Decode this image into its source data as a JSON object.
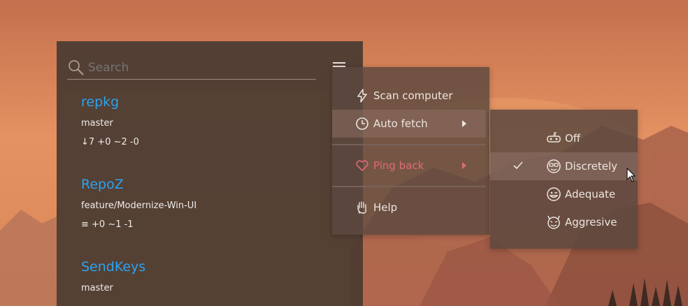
{
  "app": {
    "search": {
      "placeholder": "Search"
    },
    "repos": [
      {
        "name": "repkg",
        "branch": "master",
        "status": "↓7 +0 ~2 -0"
      },
      {
        "name": "RepoZ",
        "branch": "feature/Modernize-Win-UI",
        "status": "≡  +0 ~1 -1"
      },
      {
        "name": "SendKeys",
        "branch": "master",
        "status": ""
      }
    ]
  },
  "context_menu": {
    "items": [
      {
        "label": "Scan computer",
        "icon": "lightning-icon"
      },
      {
        "label": "Auto fetch",
        "icon": "clock-icon",
        "has_submenu": true,
        "active": true
      },
      {
        "label": "Ping back",
        "icon": "heart-icon",
        "has_submenu": true,
        "disabled": true
      },
      {
        "label": "Help",
        "icon": "hand-icon"
      }
    ]
  },
  "submenu": {
    "items": [
      {
        "label": "Off",
        "icon": "sleeping-emoji-icon",
        "checked": false
      },
      {
        "label": "Discretely",
        "icon": "nerd-emoji-icon",
        "checked": true
      },
      {
        "label": "Adequate",
        "icon": "wink-emoji-icon",
        "checked": false
      },
      {
        "label": "Aggresive",
        "icon": "devil-emoji-icon",
        "checked": false
      }
    ]
  },
  "colors": {
    "repo_name": "#2aa3f0",
    "disabled_item": "#e06a77",
    "panel_bg": "#4a3a32"
  }
}
